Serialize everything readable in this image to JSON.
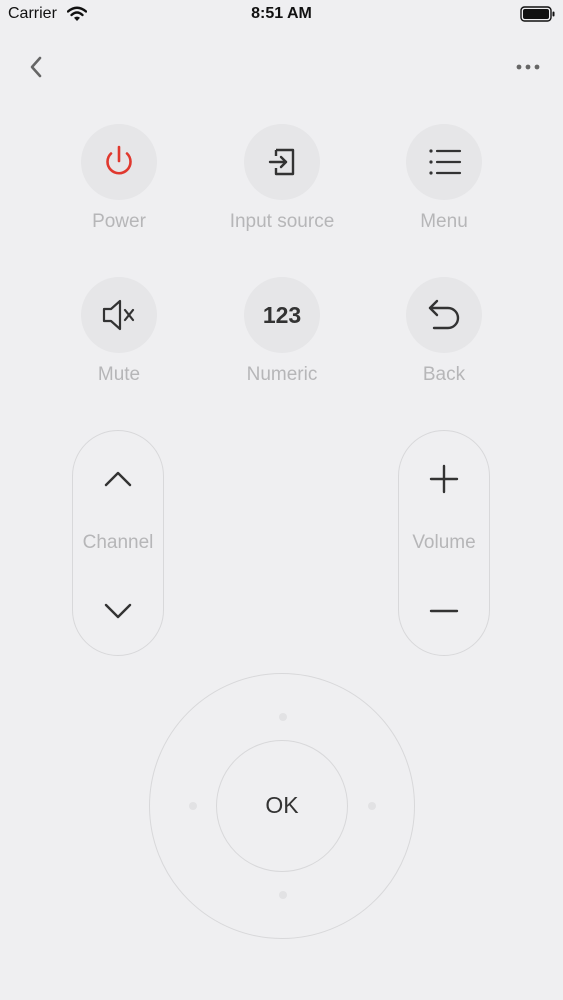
{
  "status_bar": {
    "carrier": "Carrier",
    "time": "8:51 AM",
    "icons": [
      "wifi-icon",
      "battery-icon"
    ]
  },
  "nav": {
    "back_icon": "chevron-left-icon",
    "more_icon": "more-horizontal-icon"
  },
  "functions": {
    "power": {
      "label": "Power",
      "icon": "power-icon",
      "color": "#e0382e"
    },
    "input_source": {
      "label": "Input source",
      "icon": "input-source-icon"
    },
    "menu": {
      "label": "Menu",
      "icon": "menu-list-icon"
    },
    "mute": {
      "label": "Mute",
      "icon": "mute-icon"
    },
    "numeric": {
      "label": "Numeric",
      "icon_text": "123"
    },
    "back": {
      "label": "Back",
      "icon": "return-icon"
    }
  },
  "channel": {
    "label": "Channel",
    "up_icon": "chevron-up-icon",
    "down_icon": "chevron-down-icon"
  },
  "volume": {
    "label": "Volume",
    "up_icon": "plus-icon",
    "down_icon": "minus-icon"
  },
  "dpad": {
    "ok_label": "OK"
  },
  "colors": {
    "background": "#efeff1",
    "button_circle": "#e6e6e8",
    "label_gray": "#b6b6b8",
    "icon_dark": "#333333",
    "power_red": "#e0382e"
  }
}
